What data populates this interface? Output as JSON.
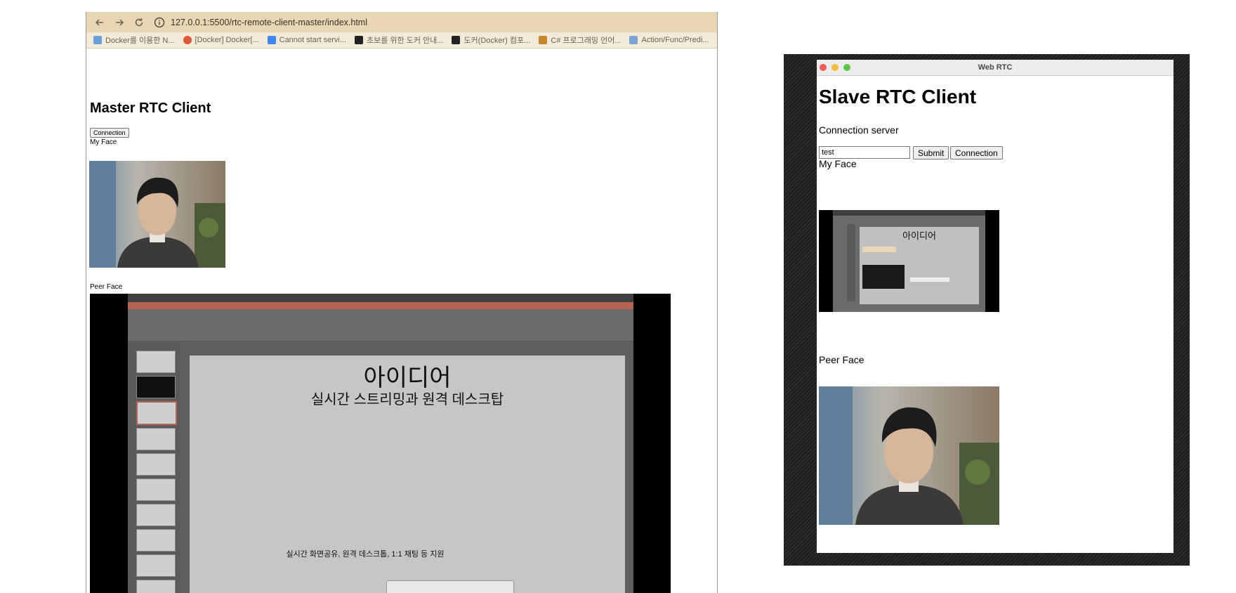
{
  "browser": {
    "url": "127.0.0.1:5500/rtc-remote-client-master/index.html",
    "bookmarks": [
      {
        "label": "Docker를 이용한 N...",
        "icon": "image-icon",
        "color": "#6aa0d8"
      },
      {
        "label": "[Docker] Docker[...",
        "icon": "t-icon",
        "color": "#e0563a"
      },
      {
        "label": "Cannot start servi...",
        "icon": "google-icon",
        "color": "#4285f4"
      },
      {
        "label": "초보를 위한 도커 안내...",
        "icon": "code-icon",
        "color": "#222222"
      },
      {
        "label": "도커(Docker) 컴포...",
        "icon": "forty-four-icon",
        "color": "#222222"
      },
      {
        "label": "C# 프로그래밍 언어...",
        "icon": "book-icon",
        "color": "#c8862a"
      },
      {
        "label": "Action/Func/Predi...",
        "icon": "doc-icon",
        "color": "#7da3d6"
      }
    ]
  },
  "master": {
    "title": "Master RTC Client",
    "connection_button": "Connection",
    "my_face_label": "My Face",
    "peer_face_label": "Peer Face",
    "shared_screen": {
      "slide_title": "아이디어",
      "slide_subtitle": "실시간 스트리밍과 원격 데스크탑",
      "slide_footer": "실시간 화면공유, 원격 데스크톱, 1:1 채팅 등 지원"
    }
  },
  "slave": {
    "window_title": "Web RTC",
    "title": "Slave RTC Client",
    "server_label": "Connection server",
    "server_input_value": "test",
    "submit_button": "Submit",
    "connection_button": "Connection",
    "my_face_label": "My Face",
    "peer_face_label": "Peer Face",
    "my_face_screen_title": "아이디어"
  }
}
